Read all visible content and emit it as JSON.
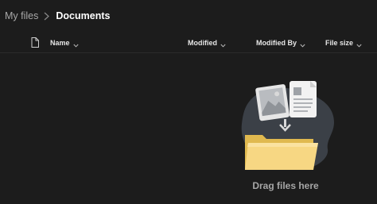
{
  "breadcrumb": {
    "root": "My files",
    "current": "Documents"
  },
  "columns": {
    "file_type_icon": "document-icon",
    "name": "Name",
    "modified": "Modified",
    "modified_by": "Modified By",
    "file_size": "File size"
  },
  "empty_state": {
    "caption": "Drag files here",
    "illustration": "drag-files-illustration"
  },
  "colors": {
    "background": "#1c1c1c",
    "folder": "#f7d783",
    "blob": "#3b4047"
  }
}
